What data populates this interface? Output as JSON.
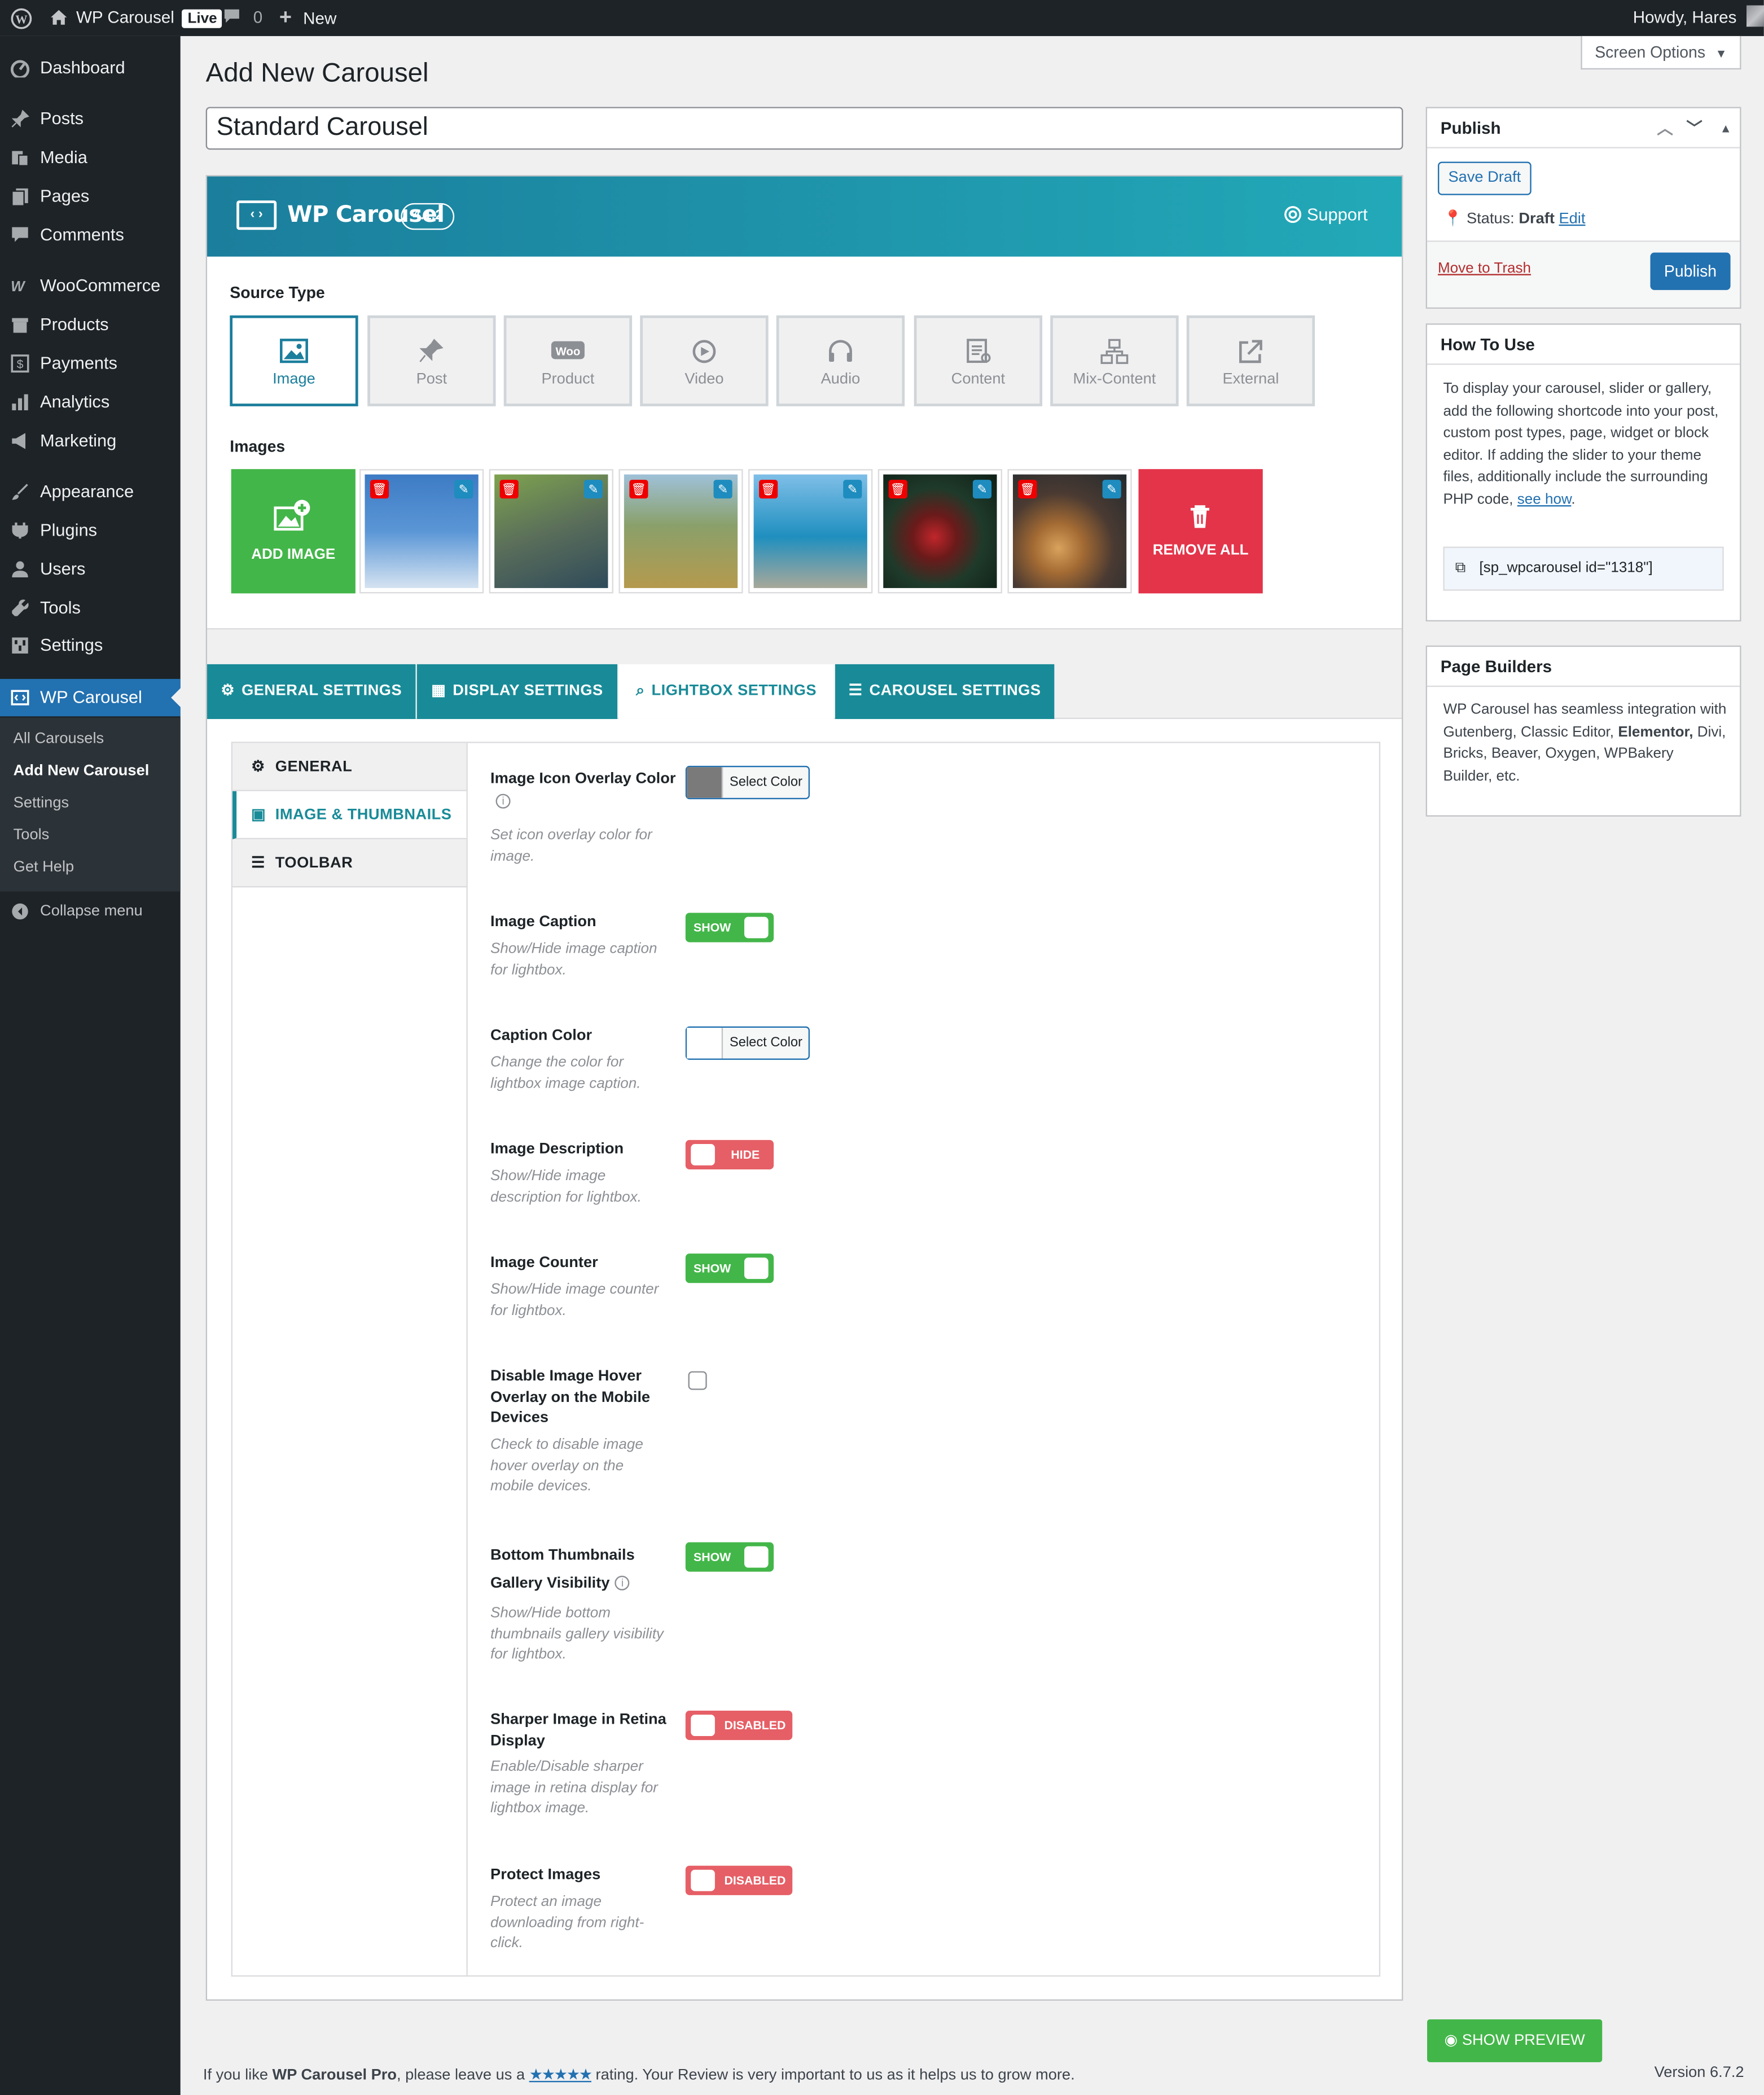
{
  "admin_bar": {
    "site_name": "WP Carousel",
    "live_badge": "Live",
    "comments_count": "0",
    "new_label": "New",
    "greeting": "Howdy, Hares"
  },
  "sidebar": {
    "items": [
      {
        "label": "Dashboard",
        "icon": "dashboard-icon"
      },
      {
        "label": "Posts",
        "icon": "pin-icon"
      },
      {
        "label": "Media",
        "icon": "media-icon"
      },
      {
        "label": "Pages",
        "icon": "pages-icon"
      },
      {
        "label": "Comments",
        "icon": "comments-icon"
      },
      {
        "label": "WooCommerce",
        "icon": "woocommerce-icon"
      },
      {
        "label": "Products",
        "icon": "products-icon"
      },
      {
        "label": "Payments",
        "icon": "payments-icon"
      },
      {
        "label": "Analytics",
        "icon": "analytics-icon"
      },
      {
        "label": "Marketing",
        "icon": "marketing-icon"
      },
      {
        "label": "Appearance",
        "icon": "appearance-icon"
      },
      {
        "label": "Plugins",
        "icon": "plugins-icon"
      },
      {
        "label": "Users",
        "icon": "users-icon"
      },
      {
        "label": "Tools",
        "icon": "tools-icon"
      },
      {
        "label": "Settings",
        "icon": "settings-icon"
      },
      {
        "label": "WP Carousel",
        "icon": "carousel-icon"
      }
    ],
    "submenu": [
      "All Carousels",
      "Add New Carousel",
      "Settings",
      "Tools",
      "Get Help"
    ],
    "collapse": "Collapse menu"
  },
  "screen_options": "Screen Options",
  "page_title": "Add New Carousel",
  "post_title_value": "Standard Carousel",
  "header": {
    "logo_text": "WP Carousel",
    "version": "4.1.2",
    "support": "Support"
  },
  "source_type": {
    "label": "Source Type",
    "options": [
      "Image",
      "Post",
      "Product",
      "Video",
      "Audio",
      "Content",
      "Mix-Content",
      "External"
    ],
    "selected": "Image"
  },
  "images": {
    "label": "Images",
    "add_label": "ADD IMAGE",
    "remove_label": "REMOVE ALL",
    "thumbnails": [
      "snowboarder-photo",
      "camping-photo",
      "hiker-photo",
      "coast-traveler-photo",
      "red-berries-photo",
      "pancakes-photo"
    ]
  },
  "tabs": [
    "GENERAL SETTINGS",
    "DISPLAY SETTINGS",
    "LIGHTBOX SETTINGS",
    "CAROUSEL SETTINGS"
  ],
  "subnav": [
    "GENERAL",
    "IMAGE & THUMBNAILS",
    "TOOLBAR"
  ],
  "fields": {
    "icon_overlay": {
      "title": "Image Icon Overlay Color",
      "desc": "Set icon overlay color for image.",
      "button": "Select Color",
      "color": "#7a7a7a"
    },
    "caption": {
      "title": "Image Caption",
      "desc": "Show/Hide image caption for lightbox.",
      "state": "SHOW"
    },
    "caption_color": {
      "title": "Caption Color",
      "desc": "Change the color for lightbox image caption.",
      "button": "Select Color",
      "color": "#ffffff"
    },
    "description": {
      "title": "Image Description",
      "desc": "Show/Hide image description for lightbox.",
      "state": "HIDE"
    },
    "counter": {
      "title": "Image Counter",
      "desc": "Show/Hide image counter for lightbox.",
      "state": "SHOW"
    },
    "hover_overlay": {
      "title": "Disable Image Hover Overlay on the Mobile Devices",
      "desc": "Check to disable image hover overlay on the mobile devices."
    },
    "thumbnails": {
      "title": "Bottom Thumbnails Gallery Visibility",
      "desc": "Show/Hide bottom thumbnails gallery visibility for lightbox.",
      "state": "SHOW"
    },
    "retina": {
      "title": "Sharper Image in Retina Display",
      "desc": "Enable/Disable sharper image in retina display for lightbox image.",
      "state": "DISABLED"
    },
    "protect": {
      "title": "Protect Images",
      "desc": "Protect an image downloading from right-click.",
      "state": "DISABLED"
    }
  },
  "publish": {
    "title": "Publish",
    "save_draft": "Save Draft",
    "status_label": "Status:",
    "status_value": "Draft",
    "edit": "Edit",
    "trash": "Move to Trash",
    "publish_btn": "Publish"
  },
  "how_to": {
    "title": "How To Use",
    "text": "To display your carousel, slider or gallery, add the following shortcode into your post, custom post types, page, widget or block editor. If adding the slider to your theme files, additionally include the surrounding PHP code,",
    "link": "see how",
    "shortcode": "[sp_wpcarousel id=\"1318\"]"
  },
  "page_builders": {
    "title": "Page Builders",
    "text_a": "WP Carousel has seamless integration with Gutenberg, Classic Editor,",
    "text_bold": "Elementor,",
    "text_b": "Divi, Bricks, Beaver, Oxygen, WPBakery Builder, etc."
  },
  "show_preview": "SHOW PREVIEW",
  "footer": {
    "text_a": "If you like",
    "brand": "WP Carousel Pro",
    "text_b": ", please leave us a",
    "stars": "★★★★★",
    "text_c": "rating. Your Review is very important to us as it helps us to grow more.",
    "version": "Version 6.7.2"
  },
  "colors": {
    "admin_dark": "#1d2327",
    "wp_blue": "#2271b1",
    "teal": "#198b98",
    "green": "#43b649",
    "red": "#e3344a"
  }
}
